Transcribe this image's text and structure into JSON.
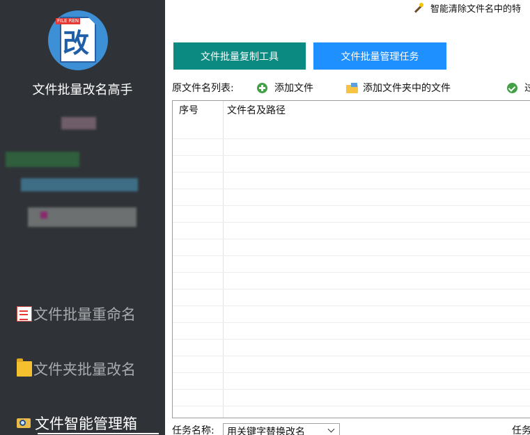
{
  "sidebar": {
    "logo_badge": "FILE REN",
    "logo_char": "改",
    "app_title": "文件批量改名高手",
    "nav": [
      {
        "label": "文件批量重命名"
      },
      {
        "label": "文件夹批量改名"
      },
      {
        "label": "文件智能管理箱"
      }
    ]
  },
  "main": {
    "tip": "智能清除文件名中的特",
    "buttons": {
      "copy_tool": "文件批量复制工具",
      "manage_task": "文件批量管理任务"
    },
    "toolbar": {
      "label": "原文件名列表:",
      "add_file": "添加文件",
      "add_folder_files": "添加文件夹中的文件",
      "right_cut": "过"
    },
    "table": {
      "col_index": "序号",
      "col_path": "文件名及路径"
    },
    "bottom": {
      "task_label": "任务名称:",
      "task_value": "用关键字替换改名",
      "right_label": "任务"
    }
  },
  "colors": {
    "sidebar_bg": "#2f3337",
    "teal": "#0b8a82",
    "blue": "#1e90ff"
  }
}
